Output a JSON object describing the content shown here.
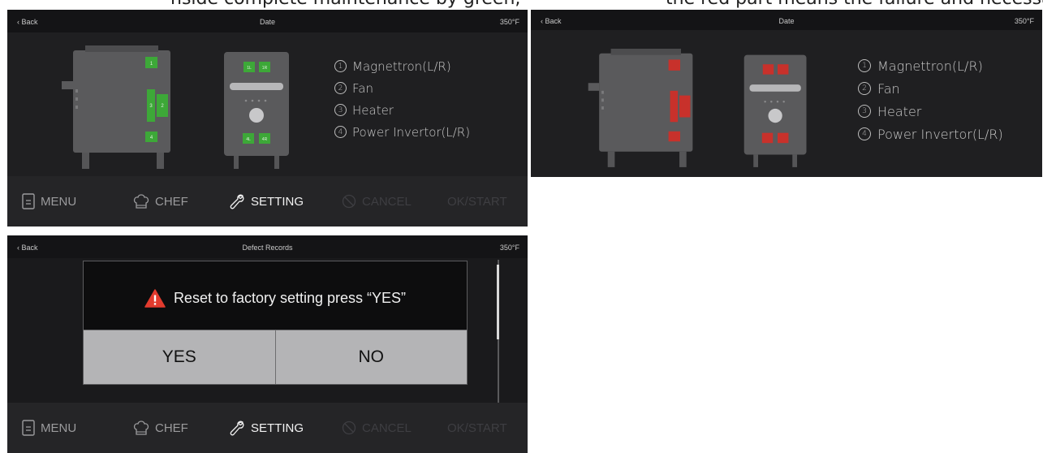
{
  "top_crop": {
    "left": "nside complete maintenance by green,",
    "right": "the red part means the failure and necessary"
  },
  "screen1": {
    "status": {
      "back": "‹ Back",
      "title": "Date",
      "temp": "350°F"
    },
    "component_labels": {
      "top": "1",
      "fan": "2",
      "heater": "3",
      "bottom": "4",
      "left_mag": "1L",
      "right_mag": "1R",
      "left_inv": "4L",
      "right_inv": "4R"
    },
    "legend": [
      {
        "num": "1",
        "text": "Magnettron(L/R)"
      },
      {
        "num": "2",
        "text": "Fan"
      },
      {
        "num": "3",
        "text": "Heater"
      },
      {
        "num": "4",
        "text": "Power Invertor(L/R)"
      }
    ],
    "nav": {
      "menu": "MENU",
      "chef": "CHEF",
      "setting": "SETTING",
      "cancel": "CANCEL",
      "ok": "OK/START"
    }
  },
  "screen2": {
    "status": {
      "back": "‹ Back",
      "title": "Date",
      "temp": "350°F"
    },
    "legend": [
      {
        "num": "1",
        "text": "Magnettron(L/R)"
      },
      {
        "num": "2",
        "text": "Fan"
      },
      {
        "num": "3",
        "text": "Heater"
      },
      {
        "num": "4",
        "text": "Power Invertor(L/R)"
      }
    ]
  },
  "screen3": {
    "status": {
      "back": "‹ Back",
      "title": "Defect Records",
      "temp": "350°F"
    },
    "dialog": {
      "message": "Reset to factory setting press “YES”",
      "yes": "YES",
      "no": "NO"
    },
    "nav": {
      "menu": "MENU",
      "chef": "CHEF",
      "setting": "SETTING",
      "cancel": "CANCEL",
      "ok": "OK/START"
    }
  },
  "colors": {
    "ok_part": "#3da838",
    "failed_part": "#c8312b",
    "oven_body": "#5a5a5c",
    "alert": "#e23b2e"
  }
}
